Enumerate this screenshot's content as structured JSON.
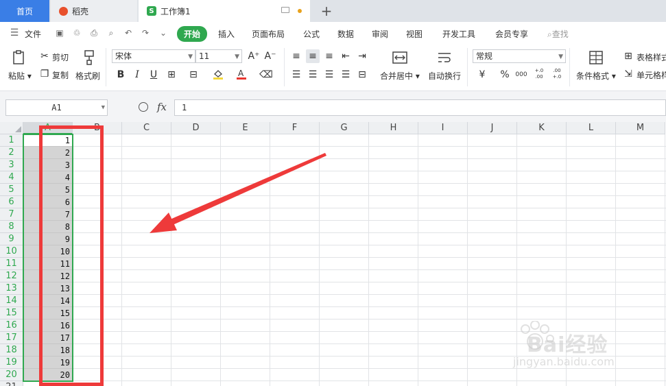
{
  "tabs": {
    "home": "首页",
    "daoke": "稻壳",
    "workbook": "工作簿1",
    "add": "+"
  },
  "menu": {
    "file": "文件",
    "start": "开始",
    "insert": "插入",
    "page_layout": "页面布局",
    "formula": "公式",
    "data": "数据",
    "review": "审阅",
    "view": "视图",
    "dev_tools": "开发工具",
    "member": "会员专享",
    "search": "查找"
  },
  "ribbon": {
    "paste": "粘贴",
    "cut": "剪切",
    "copy": "复制",
    "format_painter": "格式刷",
    "font_name": "宋体",
    "font_size": "11",
    "merge_center": "合并居中",
    "wrap_text": "自动换行",
    "number_format": "常规",
    "cond_format": "条件格式",
    "table_style": "表格样式",
    "cell_style": "单元格样式",
    "currency": "¥",
    "percent": "%",
    "thousands": "000",
    "inc_decimal": "+.0 .00",
    "dec_decimal": ".00 +.0"
  },
  "formula_bar": {
    "name_box": "A1",
    "fx": "fx",
    "value": "1"
  },
  "sheet": {
    "columns": [
      "A",
      "B",
      "C",
      "D",
      "E",
      "F",
      "G",
      "H",
      "I",
      "J",
      "K",
      "L",
      "M"
    ],
    "rows": [
      "1",
      "2",
      "3",
      "4",
      "5",
      "6",
      "7",
      "8",
      "9",
      "10",
      "11",
      "12",
      "13",
      "14",
      "15",
      "16",
      "17",
      "18",
      "19",
      "20",
      "21"
    ],
    "col_a_values": [
      "1",
      "2",
      "3",
      "4",
      "5",
      "6",
      "7",
      "8",
      "9",
      "10",
      "11",
      "12",
      "13",
      "14",
      "15",
      "16",
      "17",
      "18",
      "19",
      "20"
    ]
  },
  "watermark": {
    "brand": "Bai经验",
    "url": "jingyan.baidu.com"
  },
  "colors": {
    "accent_green": "#2fa84f",
    "tab_blue": "#3a7ee6",
    "annotation_red": "#ee3a3a"
  }
}
